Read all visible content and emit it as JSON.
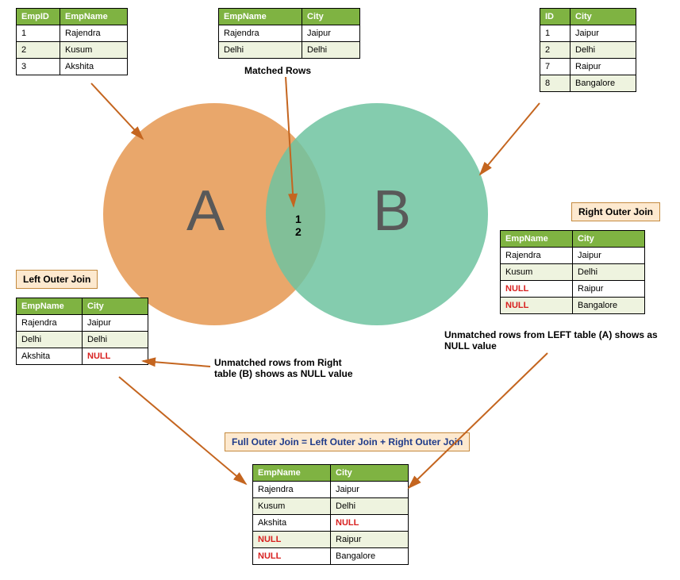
{
  "tableA": {
    "headers": [
      "EmpID",
      "EmpName"
    ],
    "rows": [
      [
        "1",
        "Rajendra"
      ],
      [
        "2",
        "Kusum"
      ],
      [
        "3",
        "Akshita"
      ]
    ]
  },
  "tableMatched": {
    "headers": [
      "EmpName",
      "City"
    ],
    "rows": [
      [
        "Rajendra",
        "Jaipur"
      ],
      [
        "Delhi",
        "Delhi"
      ]
    ]
  },
  "tableB": {
    "headers": [
      "ID",
      "City"
    ],
    "rows": [
      [
        "1",
        "Jaipur"
      ],
      [
        "2",
        "Delhi"
      ],
      [
        "7",
        "Raipur"
      ],
      [
        "8",
        "Bangalore"
      ]
    ]
  },
  "leftOuter": {
    "label": "Left Outer Join",
    "headers": [
      "EmpName",
      "City"
    ],
    "rows": [
      {
        "c": [
          "Rajendra",
          "Jaipur"
        ],
        "null": []
      },
      {
        "c": [
          "Delhi",
          "Delhi"
        ],
        "null": []
      },
      {
        "c": [
          "Akshita",
          "NULL"
        ],
        "null": [
          1
        ]
      }
    ]
  },
  "rightOuter": {
    "label": "Right Outer Join",
    "headers": [
      "EmpName",
      "City"
    ],
    "rows": [
      {
        "c": [
          "Rajendra",
          "Jaipur"
        ],
        "null": []
      },
      {
        "c": [
          "Kusum",
          "Delhi"
        ],
        "null": []
      },
      {
        "c": [
          "NULL",
          "Raipur"
        ],
        "null": [
          0
        ]
      },
      {
        "c": [
          "NULL",
          "Bangalore"
        ],
        "null": [
          0
        ]
      }
    ]
  },
  "fullOuter": {
    "label": "Full Outer Join = Left Outer Join + Right Outer Join",
    "headers": [
      "EmpName",
      "City"
    ],
    "rows": [
      {
        "c": [
          "Rajendra",
          "Jaipur"
        ],
        "null": []
      },
      {
        "c": [
          "Kusum",
          "Delhi"
        ],
        "null": []
      },
      {
        "c": [
          "Akshita",
          "NULL"
        ],
        "null": [
          1
        ]
      },
      {
        "c": [
          "NULL",
          "Raipur"
        ],
        "null": [
          0
        ]
      },
      {
        "c": [
          "NULL",
          "Bangalore"
        ],
        "null": [
          0
        ]
      }
    ]
  },
  "captions": {
    "matched": "Matched Rows",
    "unmatchedRight": "Unmatched rows from Right table (B) shows as NULL value",
    "unmatchedLeft": "Unmatched rows from LEFT table (A) shows as NULL value"
  },
  "venn": {
    "a": "A",
    "b": "B",
    "n1": "1",
    "n2": "2"
  }
}
